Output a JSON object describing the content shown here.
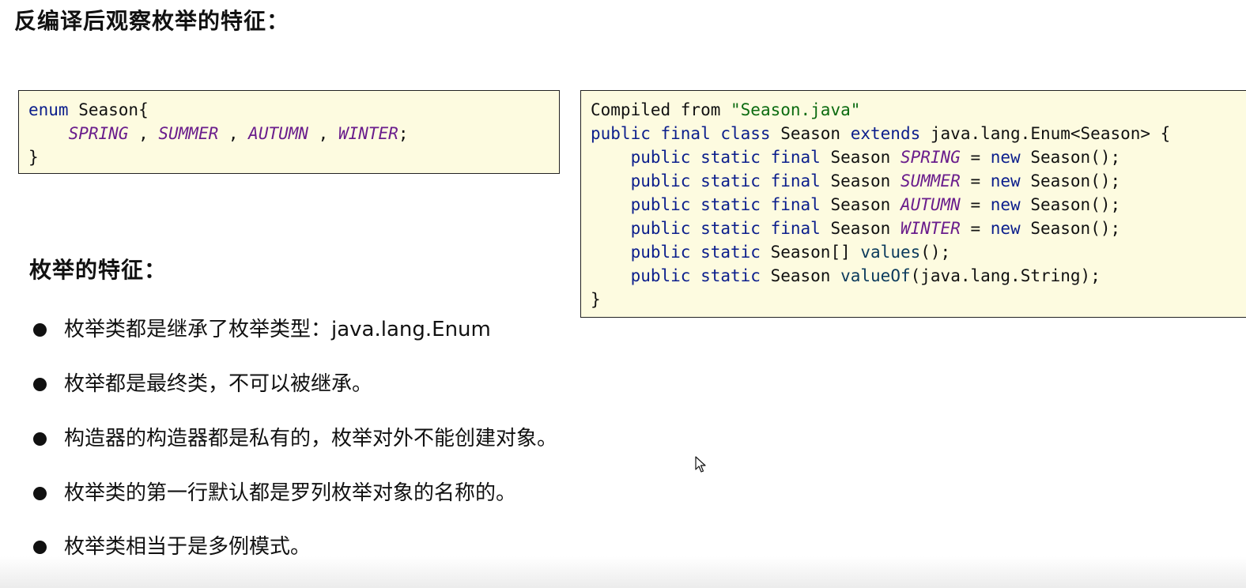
{
  "page": {
    "title": "反编译后观察枚举的特征："
  },
  "source_code": {
    "line1_kw": "enum",
    "line1_rest": " Season{",
    "const1": "SPRING",
    "const2": "SUMMER",
    "const3": "AUTUMN",
    "const4": "WINTER",
    "sep": " , ",
    "end_semicolon": ";",
    "close": "}"
  },
  "decompiled": {
    "header_prefix": "Compiled from ",
    "header_file": "\"Season.java\"",
    "class_kw": "public final class",
    "class_name": " Season ",
    "extends_kw": "extends",
    "class_tail": " java.lang.Enum<Season> {",
    "field_mods": "public static final",
    "field_type": " Season ",
    "assign": " = ",
    "new_kw": "new",
    "ctor_call": " Season();",
    "values_mods": "public static",
    "values_type": " Season[] ",
    "values_name": "values",
    "values_tail": "();",
    "valueof_mods": "public static",
    "valueof_type": " Season ",
    "valueof_name": "valueOf",
    "valueof_tail": "(java.lang.String);",
    "close": "}"
  },
  "features": {
    "heading": "枚举的特征：",
    "items": [
      "枚举类都是继承了枚举类型：java.lang.Enum",
      "枚举都是最终类，不可以被继承。",
      "构造器的构造器都是私有的，枚举对外不能创建对象。",
      "枚举类的第一行默认都是罗列枚举对象的名称的。",
      "枚举类相当于是多例模式。"
    ]
  },
  "colors": {
    "code_background": "#fdfbe0",
    "keyword": "#0b1e8c",
    "enum_constant": "#6a1d8c",
    "string": "#0c6b10"
  },
  "icons": {
    "cursor": "mouse-pointer-icon",
    "bullet": "filled-circle"
  }
}
